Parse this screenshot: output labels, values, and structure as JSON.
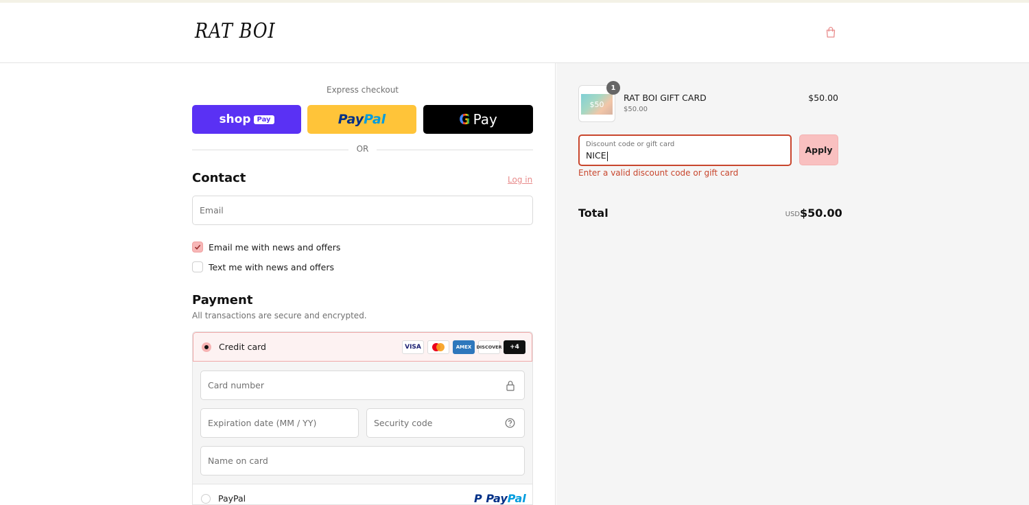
{
  "header": {
    "logo_text": "RAT BOI",
    "cart_icon": "shopping-bag-icon",
    "accent": "#e88a8a"
  },
  "express": {
    "label": "Express checkout",
    "shop_pay": {
      "text": "shop",
      "pill": "Pay",
      "color": "#5a31f4"
    },
    "paypal": {
      "part1": "Pay",
      "part2": "Pal",
      "color": "#ffc439"
    },
    "gpay": {
      "g": "G",
      "text": "Pay",
      "color": "#000000"
    },
    "separator": "OR"
  },
  "contact": {
    "title": "Contact",
    "login_link": "Log in",
    "email_placeholder": "Email",
    "news_email": {
      "label": "Email me with news and offers",
      "checked": true
    },
    "news_text": {
      "label": "Text me with news and offers",
      "checked": false
    }
  },
  "payment": {
    "title": "Payment",
    "subtitle": "All transactions are secure and encrypted.",
    "credit_card": {
      "label": "Credit card",
      "selected": true,
      "brands": [
        "VISA",
        "Mastercard",
        "AMEX",
        "DISCOVER",
        "+4"
      ],
      "card_number_placeholder": "Card number",
      "expiry_placeholder": "Expiration date (MM / YY)",
      "security_placeholder": "Security code",
      "name_placeholder": "Name on card"
    },
    "paypal_option": {
      "label": "PayPal",
      "logo_p1": "Pay",
      "logo_p2": "Pal",
      "selected": false
    }
  },
  "summary": {
    "item": {
      "name": "RAT BOI GIFT CARD",
      "sub_price": "$50.00",
      "price": "$50.00",
      "quantity": "1",
      "thumb_text": "$50"
    },
    "discount": {
      "label": "Discount code or gift card",
      "value": "NICE",
      "apply_label": "Apply",
      "error": "Enter a valid discount code or gift card",
      "error_color": "#c8452c"
    },
    "total": {
      "label": "Total",
      "currency": "USD",
      "value": "$50.00"
    }
  }
}
